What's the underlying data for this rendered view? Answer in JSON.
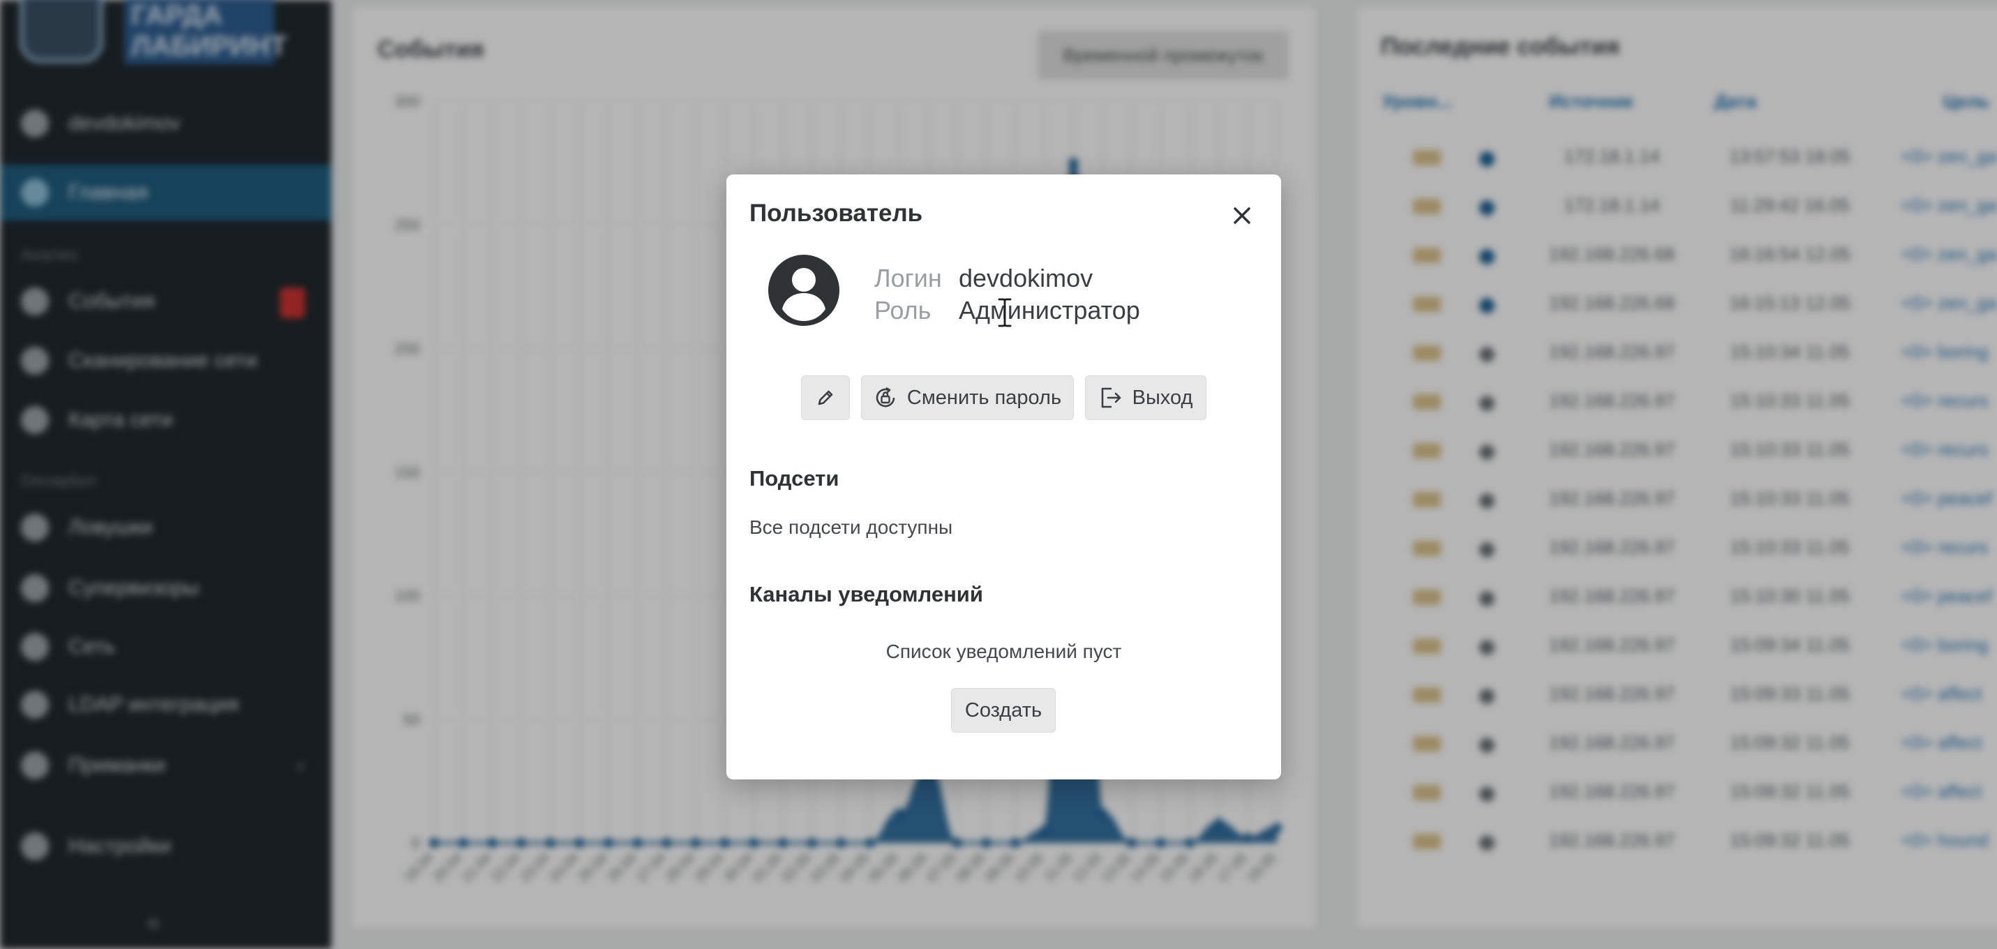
{
  "sidebar": {
    "logo_text": "ГАРДА ЛАБИРИНТ",
    "user": "devdokimov",
    "main_item": "Главная",
    "section_analysis": "Анализ",
    "items_analysis": [
      "События",
      "Сканирование сети",
      "Карта сети"
    ],
    "section_deception": "Deception",
    "items_deception": [
      "Ловушки",
      "Супервизоры",
      "Сеть",
      "LDAP интеграция",
      "Приманки"
    ],
    "settings": "Настройки",
    "collapse": "«"
  },
  "events": {
    "title": "События",
    "range_button": "Временной промежуток"
  },
  "chart_data": {
    "type": "area",
    "yticks": [
      "300",
      "250",
      "200",
      "150",
      "100",
      "50",
      "0"
    ],
    "ylim": [
      0,
      300
    ],
    "xlabels": [
      "18.04",
      "20.04",
      "21.04",
      "22.04",
      "23.04",
      "24.04",
      "25.04",
      "26.04",
      "27.04",
      "28.04",
      "29.04",
      "30.04",
      "01.05",
      "02.05",
      "03.05",
      "04.05",
      "05.05",
      "06.05",
      "07.05",
      "08.05",
      "09.05",
      "10.05",
      "11.05",
      "12.05",
      "13.05",
      "14.05",
      "15.05",
      "16.05",
      "17.05",
      "18.05"
    ],
    "values": [
      0,
      0,
      0,
      0,
      0,
      0,
      0,
      0,
      0,
      0,
      0,
      0,
      0,
      0,
      0,
      0,
      12,
      30,
      0,
      0,
      0,
      5,
      275,
      12,
      0,
      0,
      0,
      8,
      2,
      6
    ]
  },
  "recent": {
    "title": "Последние события",
    "headers": [
      "Уровн...",
      "Источник",
      "Дата",
      "Цель"
    ],
    "rows": [
      {
        "src": "172.18.1.14",
        "date": "13:57:53 18.05",
        "target": "<0> zen_ga",
        "dot": "#1d5f94"
      },
      {
        "src": "172.18.1.14",
        "date": "11:29:42 16.05",
        "target": "<0> zen_ga",
        "dot": "#1d5f94"
      },
      {
        "src": "192.168.226.68",
        "date": "16:16:54 12.05",
        "target": "<0> zen_ga",
        "dot": "#1d5f94"
      },
      {
        "src": "192.168.226.68",
        "date": "16:15:13 12.05",
        "target": "<0> zen_ga",
        "dot": "#1d5f94"
      },
      {
        "src": "192.168.226.97",
        "date": "15:10:34 11.05",
        "target": "<0> boring",
        "dot": "#6c7074"
      },
      {
        "src": "192.168.226.97",
        "date": "15:10:33 11.05",
        "target": "<0> recurs",
        "dot": "#6c7074"
      },
      {
        "src": "192.168.226.97",
        "date": "15:10:33 11.05",
        "target": "<0> recurs",
        "dot": "#6c7074"
      },
      {
        "src": "192.168.226.97",
        "date": "15:10:33 11.05",
        "target": "<0> peacef",
        "dot": "#6c7074"
      },
      {
        "src": "192.168.226.97",
        "date": "15:10:33 11.05",
        "target": "<0> recurs",
        "dot": "#6c7074"
      },
      {
        "src": "192.168.226.97",
        "date": "15:10:30 11.05",
        "target": "<0> peacef",
        "dot": "#6c7074"
      },
      {
        "src": "192.168.226.97",
        "date": "15:09:34 11.05",
        "target": "<0> boring",
        "dot": "#6c7074"
      },
      {
        "src": "192.168.226.97",
        "date": "15:09:33 11.05",
        "target": "<0> affect",
        "dot": "#6c7074"
      },
      {
        "src": "192.168.226.97",
        "date": "15:09:32 11.05",
        "target": "<0> affect",
        "dot": "#6c7074"
      },
      {
        "src": "192.168.226.97",
        "date": "15:09:32 11.05",
        "target": "<0> affect",
        "dot": "#6c7074"
      },
      {
        "src": "192.168.226.97",
        "date": "15:09:32 11.05",
        "target": "<0> hound",
        "dot": "#6c7074"
      }
    ]
  },
  "modal": {
    "title": "Пользователь",
    "login_label": "Логин",
    "login_value": "devdokimov",
    "role_label": "Роль",
    "role_value": "Администратор",
    "change_password": "Сменить пароль",
    "logout": "Выход",
    "subnets_title": "Подсети",
    "subnets_text": "Все подсети доступны",
    "channels_title": "Каналы уведомлений",
    "channels_empty": "Список уведомлений пуст",
    "create": "Создать"
  },
  "colors": {
    "sidebar_bg": "#20282d",
    "sidebar_active": "#1f5d7d",
    "chart_fill": "#1d5f94",
    "link_blue": "#1e6fae",
    "overlay": "rgba(0,0,0,0.28)"
  },
  "icons": [
    "close-icon",
    "user-avatar-icon",
    "edit-pencil-icon",
    "lock-reset-icon",
    "logout-icon",
    "text-cursor-icon"
  ]
}
